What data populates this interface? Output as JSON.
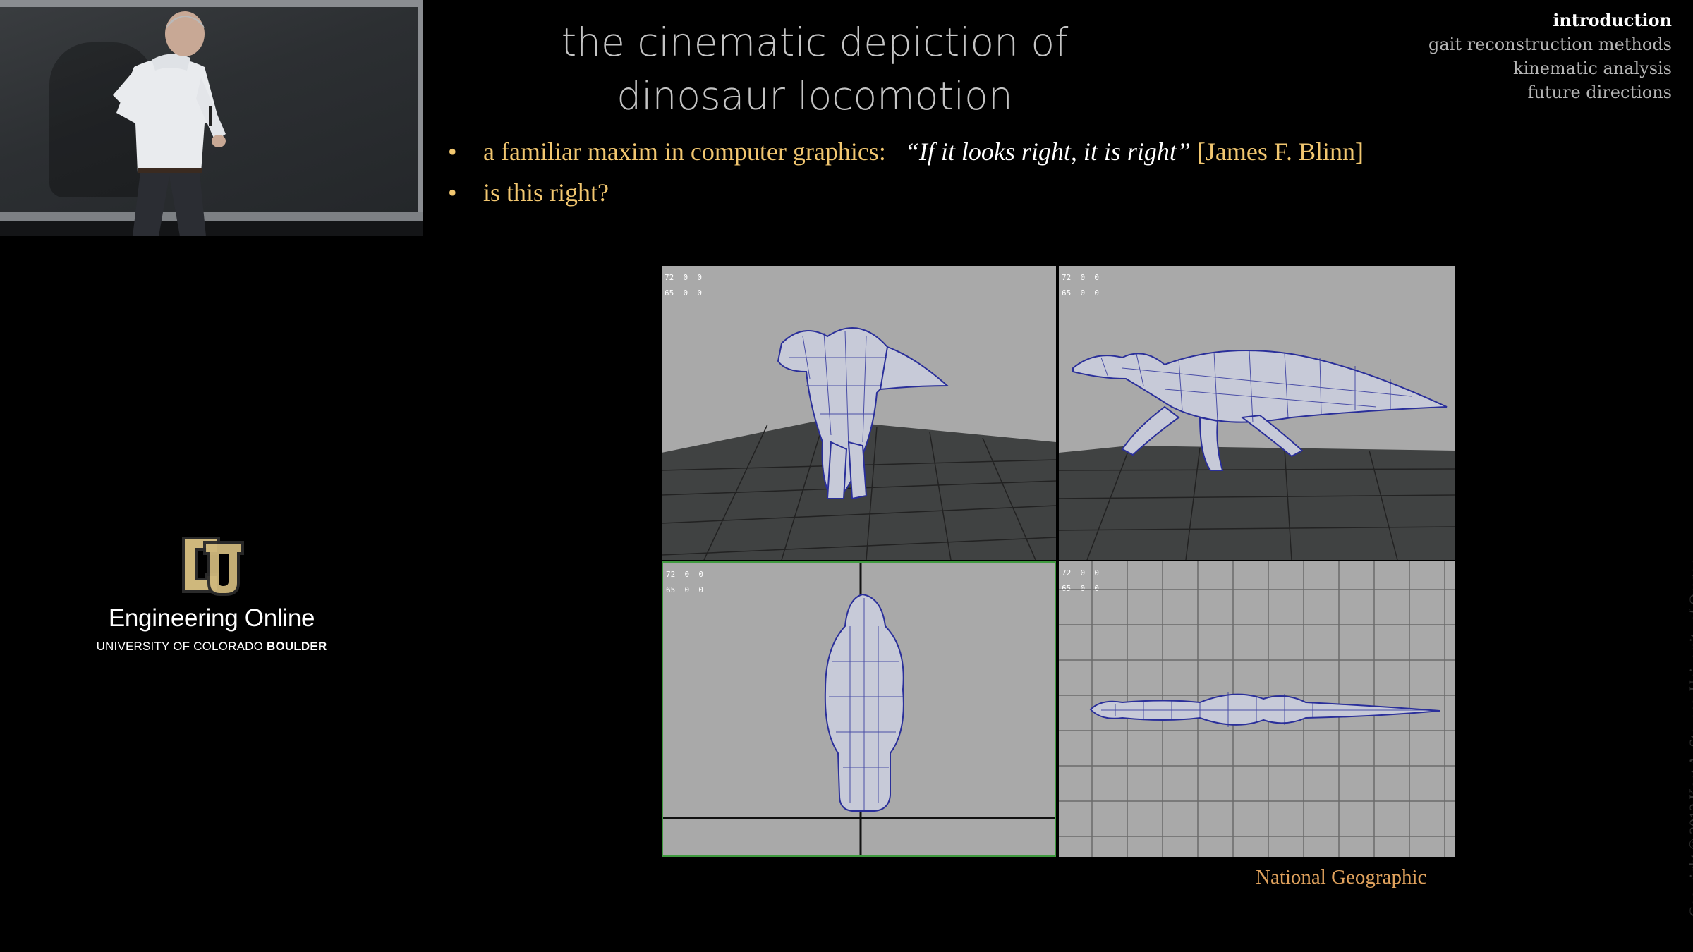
{
  "slide": {
    "title_line1": "the cinematic depiction of",
    "title_line2": "dinosaur locomotion",
    "bullets": [
      {
        "prefix": "a familiar maxim in computer graphics:",
        "quote": "“If it looks right, it is right”",
        "cite": "[James F. Blinn]"
      },
      {
        "text": "is this right?"
      }
    ],
    "credit": "National Geographic",
    "copyright": "Copyright © 2012 Kent A. Stevens, University of Oregon"
  },
  "nav": {
    "items": [
      {
        "label": "introduction",
        "active": true
      },
      {
        "label": "gait reconstruction methods",
        "active": false
      },
      {
        "label": "kinematic analysis",
        "active": false
      },
      {
        "label": "future directions",
        "active": false
      }
    ]
  },
  "viewports": {
    "hud_text": "72  0  0\n65  0  0"
  },
  "branding": {
    "logo_letters": "CU",
    "engineering_online": "Engineering Online",
    "university": "UNIVERSITY OF COLORADO",
    "campus": "BOULDER"
  },
  "colors": {
    "bullet_accent": "#f2c770",
    "credit": "#e0a25d",
    "viewport_bg": "#a9a9a9",
    "mesh": "#2a2f9a",
    "logo_gold": "#cfb87c"
  }
}
